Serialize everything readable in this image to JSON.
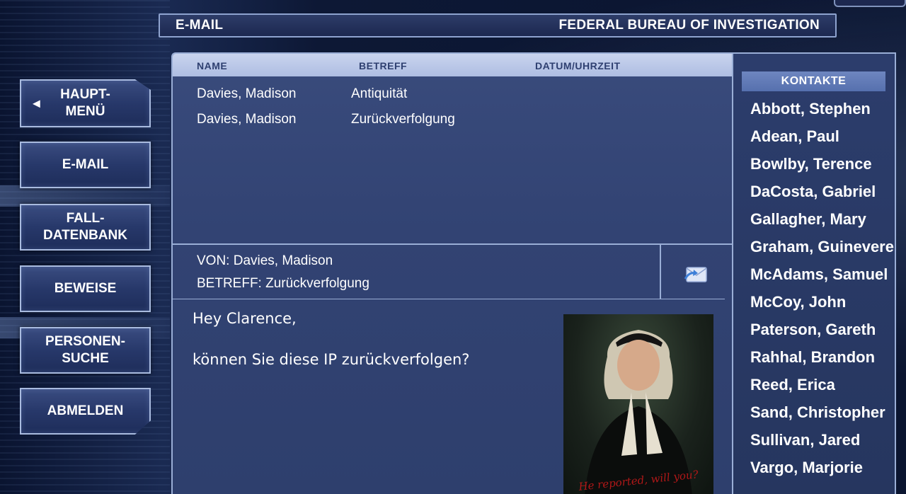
{
  "header": {
    "left_title": "E-MAIL",
    "right_title": "FEDERAL BUREAU OF INVESTIGATION"
  },
  "nav": {
    "main_menu": "HAUPT-\nMENÜ",
    "email": "E-MAIL",
    "case_db": "FALL-\nDATENBANK",
    "evidence": "BEWEISE",
    "person_search": "PERSONEN-\nSUCHE",
    "logout": "ABMELDEN"
  },
  "inbox": {
    "columns": [
      "NAME",
      "BETREFF",
      "DATUM/UHRZEIT"
    ],
    "rows": [
      {
        "name": "Davies, Madison",
        "subject": "Antiquität",
        "datetime": ""
      },
      {
        "name": "Davies, Madison",
        "subject": "Zurückverfolgung",
        "datetime": ""
      }
    ]
  },
  "message": {
    "from": "VON: Davies, Madison",
    "subject": "BETREFF: Zurückverfolgung",
    "greeting": "Hey Clarence,",
    "body": "können Sie diese IP zurückverfolgen?",
    "image_caption": "He reported, will you?"
  },
  "contacts": {
    "title": "KONTAKTE",
    "items": [
      "Abbott, Stephen",
      "Adean, Paul",
      "Bowlby, Terence",
      "DaCosta, Gabriel",
      "Gallagher, Mary",
      "Graham, Guinevere",
      "McAdams, Samuel",
      "McCoy, John",
      "Paterson, Gareth",
      "Rahhal, Brandon",
      "Reed, Erica",
      "Sand, Christopher",
      "Sullivan, Jared",
      "Vargo, Marjorie"
    ]
  },
  "colors": {
    "panel": "#324373",
    "header_strip": "#c9d4ee",
    "contacts_header": "#5670ae",
    "border": "#9aaed6"
  }
}
